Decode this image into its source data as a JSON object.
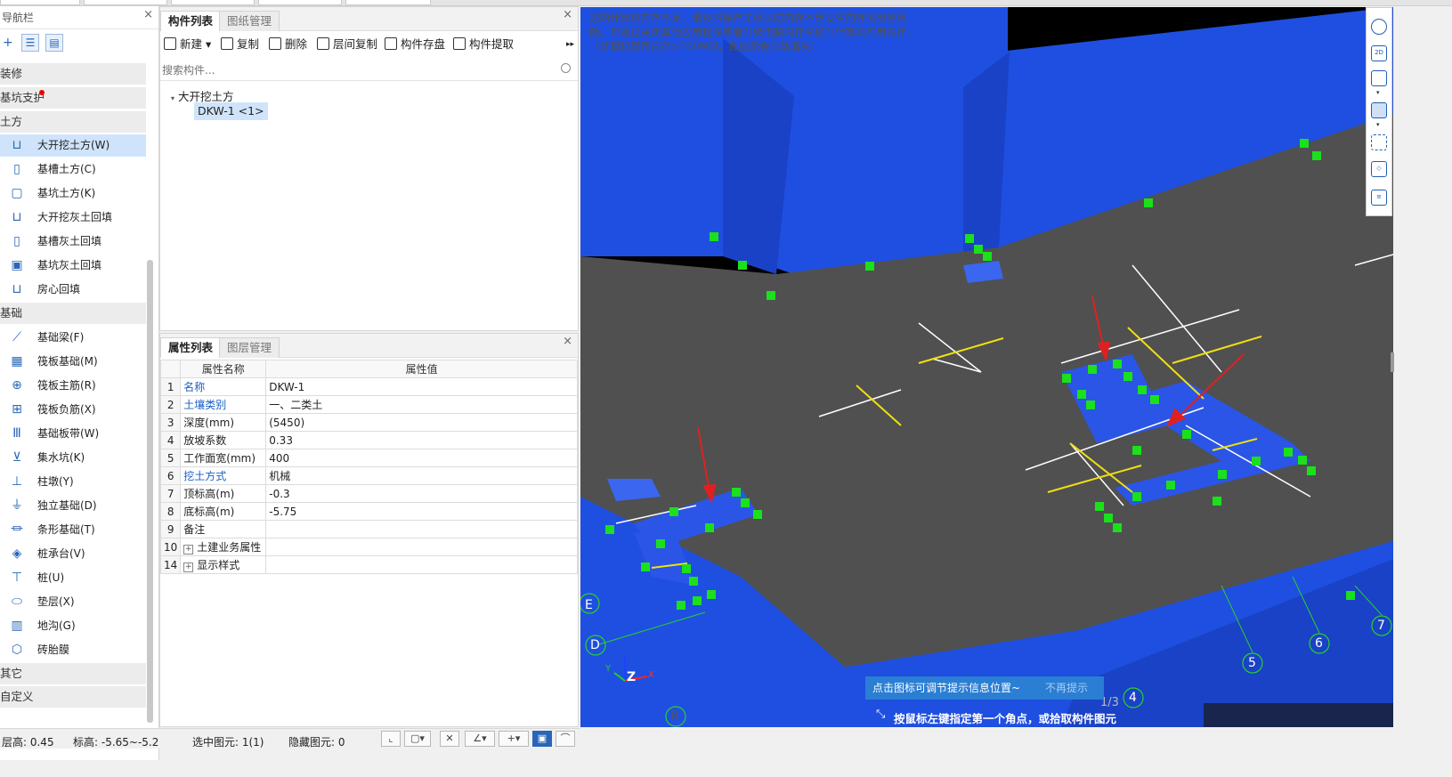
{
  "nav": {
    "title": "导航栏",
    "groups": [
      "装修",
      "基坑支护",
      "土方",
      "基础",
      "其它",
      "自定义"
    ],
    "earthwork_items": [
      "大开挖土方(W)",
      "基槽土方(C)",
      "基坑土方(K)",
      "大开挖灰土回填",
      "基槽灰土回填",
      "基坑灰土回填",
      "房心回填"
    ],
    "foundation_items": [
      "基础梁(F)",
      "筏板基础(M)",
      "筏板主筋(R)",
      "筏板负筋(X)",
      "基础板带(W)",
      "集水坑(K)",
      "柱墩(Y)",
      "独立基础(D)",
      "条形基础(T)",
      "桩承台(V)",
      "桩(U)",
      "垫层(X)",
      "地沟(G)",
      "砖胎膜"
    ]
  },
  "component_panel": {
    "tabs": [
      "构件列表",
      "图纸管理"
    ],
    "toolbar": [
      "新建",
      "复制",
      "删除",
      "层间复制",
      "构件存盘",
      "构件提取"
    ],
    "search_placeholder": "搜索构件...",
    "tree_root": "大开挖土方",
    "tree_node": "DKW-1  <1>"
  },
  "property_panel": {
    "tabs": [
      "属性列表",
      "图层管理"
    ],
    "col_name": "属性名称",
    "col_value": "属性值",
    "rows": [
      {
        "no": "1",
        "name": "名称",
        "value": "DKW-1"
      },
      {
        "no": "2",
        "name": "土壤类别",
        "value": "一、二类土"
      },
      {
        "no": "3",
        "name": "深度(mm)",
        "value": "(5450)"
      },
      {
        "no": "4",
        "name": "放坡系数",
        "value": "0.33"
      },
      {
        "no": "5",
        "name": "工作面宽(mm)",
        "value": "400"
      },
      {
        "no": "6",
        "name": "挖土方式",
        "value": "机械"
      },
      {
        "no": "7",
        "name": "顶标高(m)",
        "value": "-0.3"
      },
      {
        "no": "8",
        "name": "底标高(m)",
        "value": "-5.75"
      },
      {
        "no": "9",
        "name": "备注",
        "value": ""
      },
      {
        "no": "10",
        "name": "土建业务属性",
        "value": ""
      },
      {
        "no": "14",
        "name": "显示样式",
        "value": ""
      }
    ]
  },
  "status": {
    "floor_height": "层高:  0.45",
    "elevation": "标高:  -5.65~-5.2",
    "selected": "选中图元:  1(1)",
    "hidden": "隐藏图元:  0"
  },
  "viewport": {
    "warning": "您的计算机内存不足，请及时保存工程以防内存不足发生内存溢出等风险。可通过关闭其他应用程序或者升级电脑内存来提升计算机可用内存。（计算机可用内存>200M时，此提示会自动消失）",
    "hint_text": "点击图标可调节提示信息位置~",
    "hint_dismiss": "不再提示",
    "instruction": "按鼠标左键指定第一个角点，或拾取构件图元",
    "page": "1/3",
    "axis_labels": [
      "E",
      "D",
      "B",
      "4",
      "5",
      "6",
      "7"
    ],
    "axis_letters": [
      "Y",
      "X",
      "Z"
    ]
  }
}
